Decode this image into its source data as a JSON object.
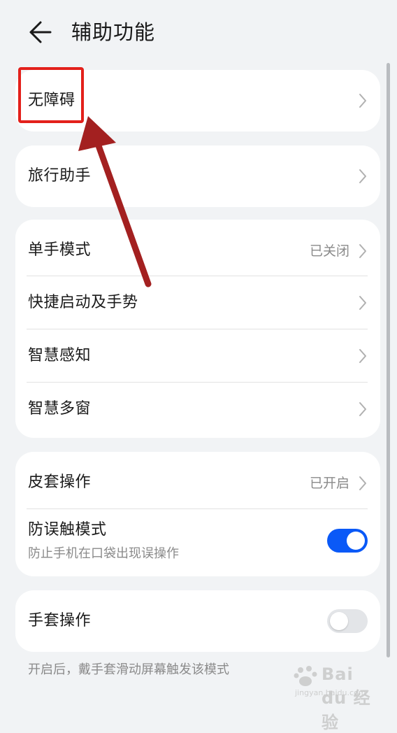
{
  "header": {
    "title": "辅助功能"
  },
  "cards": {
    "accessibility": {
      "label": "无障碍"
    },
    "travel": {
      "label": "旅行助手"
    },
    "group1": {
      "one_hand": {
        "label": "单手模式",
        "value": "已关闭"
      },
      "shortcut": {
        "label": "快捷启动及手势"
      },
      "smart_sense": {
        "label": "智慧感知"
      },
      "smart_window": {
        "label": "智慧多窗"
      }
    },
    "group2": {
      "cover": {
        "label": "皮套操作",
        "value": "已开启"
      },
      "mistouch": {
        "label": "防误触模式",
        "sub": "防止手机在口袋出现误操作",
        "toggle_on": true
      }
    },
    "gloves": {
      "label": "手套操作",
      "toggle_on": false
    }
  },
  "footnote": "开启后，戴手套滑动屏幕触发该模式",
  "watermark": {
    "text": "Bai du 经验",
    "url": "jingyan.baidu.com"
  },
  "colors": {
    "accent": "#0a59f7",
    "annotation": "#e3201b",
    "arrow": "#a32020"
  }
}
